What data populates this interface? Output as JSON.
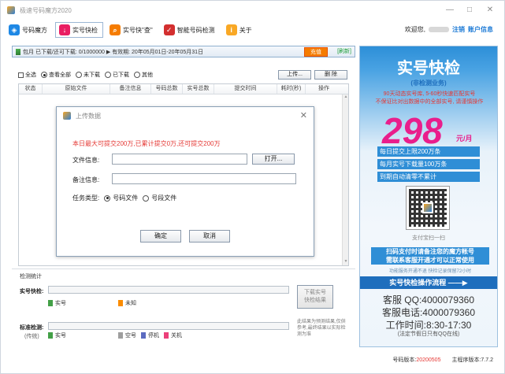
{
  "window": {
    "title": "极速号码魔方2020"
  },
  "toolbar": {
    "items": [
      {
        "label": "号码魔方",
        "icon": "cube-icon",
        "color": "#1e88e5"
      },
      {
        "label": "实号快检",
        "icon": "download-icon",
        "color": "#e91e63"
      },
      {
        "label": "实号快\"查\"",
        "icon": "search-icon",
        "color": "#f57c00"
      },
      {
        "label": "智能号码检测",
        "icon": "check-icon",
        "color": "#d32f2f"
      },
      {
        "label": "关于",
        "icon": "info-icon",
        "color": "#f9a825"
      }
    ],
    "welcome": "欢迎您,",
    "logout": "注销",
    "account": "账户信息"
  },
  "status": {
    "text": "包月  已下载/还可下载: 0/1000000  ▶ 有效期: 20年05月01日-20年05月31日",
    "charge": "充值",
    "refresh": "[刷新]"
  },
  "filters": {
    "select_all": "全选",
    "view_all": "查看全部",
    "not_downloaded": "未下载",
    "downloaded": "已下载",
    "other": "其他"
  },
  "actions": {
    "upload": "上传...",
    "delete": "删 除"
  },
  "table": {
    "columns": [
      "状态",
      "原始文件",
      "备注信息",
      "号码总数",
      "实号总数",
      "提交时间",
      "耗时(秒)",
      "操作"
    ]
  },
  "dialog": {
    "title": "上传数据",
    "notice": "本日最大可提交200万,已累计提交0万,还可提交200万",
    "file_label": "文件信息:",
    "file_value": "",
    "open": "打开...",
    "remark_label": "备注信息:",
    "remark_value": "",
    "task_type_label": "任务类型:",
    "task_opt_number": "号码文件",
    "task_opt_segment": "号段文件",
    "ok": "确定",
    "cancel": "取消"
  },
  "tasks": {
    "title": "检测统计",
    "real_check_label": "实号快检:",
    "legend_real": "实号",
    "legend_unknown": "未知",
    "standard_label": "标准检测:",
    "standard_sub": "(传统)",
    "legend_real2": "实号",
    "legend_empty": "空号",
    "legend_shutdown": "停机",
    "legend_closed": "关机",
    "download_btn": "下载实号\n快检结果",
    "note": "此结果为预测结果,仅供参考,最终结果以实际检测为准"
  },
  "colors": {
    "real": "#43a047",
    "unknown": "#fb8c00",
    "empty": "#9e9e9e",
    "shutdown": "#5c6bc0",
    "closed": "#ec407a"
  },
  "ad": {
    "title": "实号快检",
    "subtitle": "(非检测业务)",
    "desc": "90天动态实号库, 5-60秒快速匹配实号\n不保证比对出数据中的全部实号, 请谨慎操作",
    "price": "298",
    "unit": "元/月",
    "bullet1": "每日提交上限200万条",
    "bullet2": "每月实号下载量100万条",
    "bullet3": "到期自动清零不累计",
    "pay": "支付宝扫一扫",
    "highlight": "扫码支付时请备注您的魔方帐号\n需联系客服开通才可以正常使用",
    "small": "功能服务开通不退    快检记录保留72小时",
    "flow": "实号快检操作流程 ——▶",
    "qq": "客服 QQ:4000079360",
    "phone": "客服电话:4000079360",
    "hours": "工作时间:8:30-17:30",
    "holiday": "(法定节假日只有QQ在线)"
  },
  "footer": {
    "number_version_label": "号码版本:",
    "number_version": "20200505",
    "program_version_label": "主程序版本:",
    "program_version": "7.7.2"
  }
}
